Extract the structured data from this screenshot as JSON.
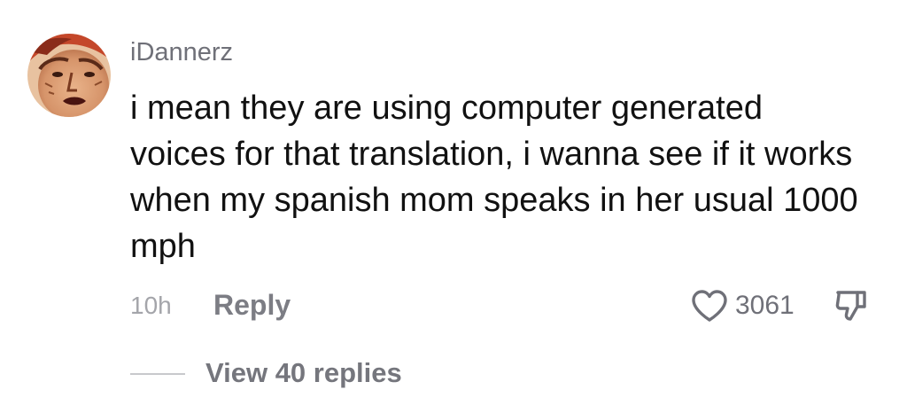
{
  "comment": {
    "username": "iDannerz",
    "text": "i mean they are using computer generated voices for that translation, i wanna see if it works when my spanish mom speaks in her usual 1000 mph",
    "timestamp": "10h",
    "reply_label": "Reply",
    "like_count": "3061",
    "view_replies_label": "View 40 replies"
  },
  "icons": {
    "avatar": "user-avatar",
    "like": "heart-outline-icon",
    "dislike": "thumbs-down-icon"
  },
  "colors": {
    "username": "#6f7078",
    "text": "#111111",
    "muted": "#a4a5aa",
    "action": "#7c7d84"
  }
}
